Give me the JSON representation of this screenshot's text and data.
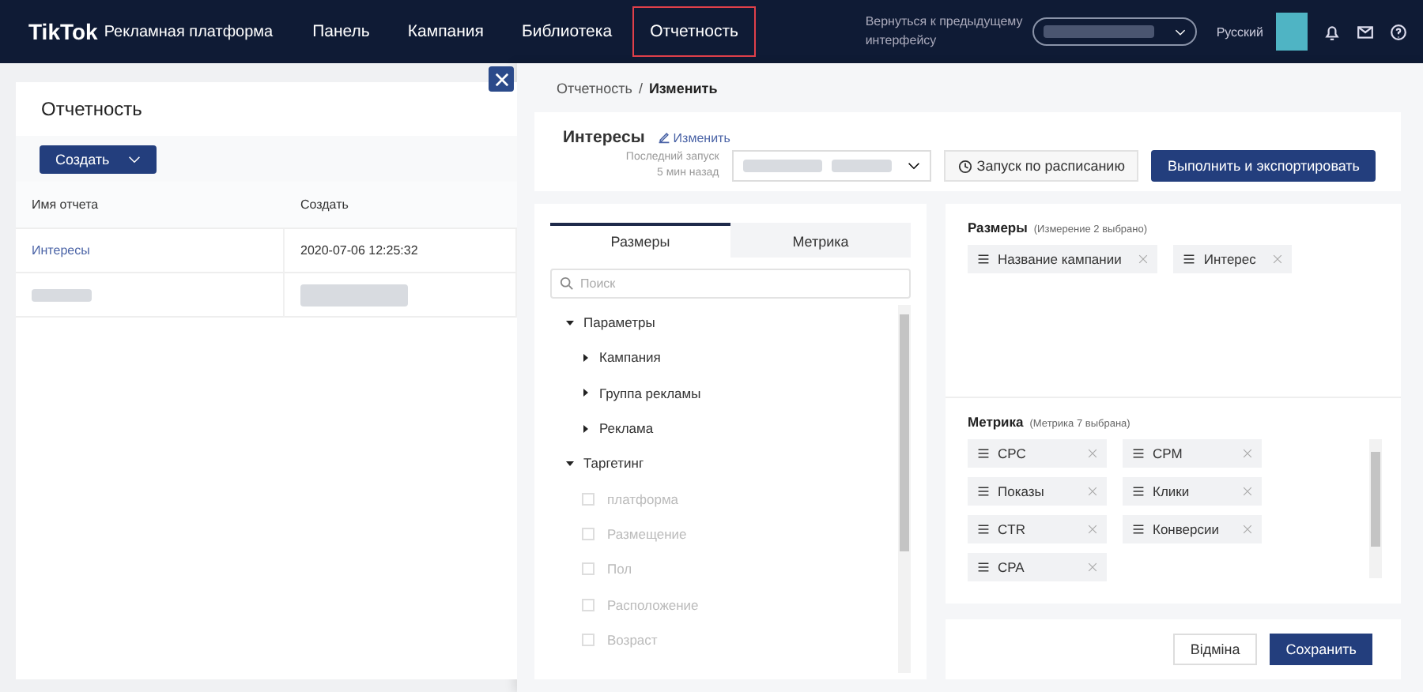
{
  "nav": {
    "logo": "TikTok",
    "logo_suffix": "Рекламная платформа",
    "items": [
      {
        "label": "Панель",
        "selected": false
      },
      {
        "label": "Кампания",
        "selected": false
      },
      {
        "label": "Библиотека",
        "selected": false
      },
      {
        "label": "Отчетность",
        "selected": true
      }
    ],
    "back_link": "Вернуться к предыдущему интерфейсу",
    "language": "Русский"
  },
  "reports": {
    "title": "Отчетность",
    "create_button": "Создать",
    "columns": [
      "Имя отчета",
      "Создать"
    ],
    "rows": [
      {
        "name": "Интересы",
        "created": "2020-07-06 12:25:32"
      }
    ]
  },
  "editor": {
    "breadcrumb": [
      "Отчетность",
      "/",
      "Изменить"
    ],
    "report_name": "Интересы",
    "edit_link": "Изменить",
    "last_run": [
      "Последний запуск",
      "5 мин назад"
    ],
    "schedule_button": "Запуск по расписанию",
    "run_button": "Выполнить и экспортировать",
    "tabs": [
      {
        "label": "Размеры",
        "selected": true
      },
      {
        "label": "Метрика",
        "selected": false
      }
    ],
    "search": {
      "placeholder": "Поиск"
    },
    "tree": [
      {
        "label": "Параметры",
        "expanded": true,
        "children": [
          {
            "label": "Кампания",
            "expanded": false
          },
          {
            "label": "Группа рекламы",
            "expanded": false
          },
          {
            "label": "Реклама",
            "expanded": false
          }
        ]
      },
      {
        "label": "Таргетинг",
        "expanded": true,
        "children": [
          {
            "label": "платформа",
            "kind": "checkbox",
            "checked": false,
            "disabled": true
          },
          {
            "label": "Размещение",
            "kind": "checkbox",
            "checked": false,
            "disabled": true
          },
          {
            "label": "Пол",
            "kind": "checkbox",
            "checked": false,
            "disabled": true
          },
          {
            "label": "Расположение",
            "kind": "checkbox",
            "checked": false,
            "disabled": true
          },
          {
            "label": "Возраст",
            "kind": "checkbox",
            "checked": false,
            "disabled": true
          }
        ]
      }
    ],
    "dimensions": {
      "title": "Размеры",
      "note": "(Измерение 2 выбрано)",
      "chips": [
        "Название кампании",
        "Интерес"
      ]
    },
    "metrics": {
      "title": "Метрика",
      "note": "(Метрика 7 выбрана)",
      "chips": [
        "CPC",
        "CPM",
        "Показы",
        "Клики",
        "CTR",
        "Конверсии",
        "CPA"
      ]
    },
    "cancel_button": "Відміна",
    "save_button": "Сохранить"
  }
}
